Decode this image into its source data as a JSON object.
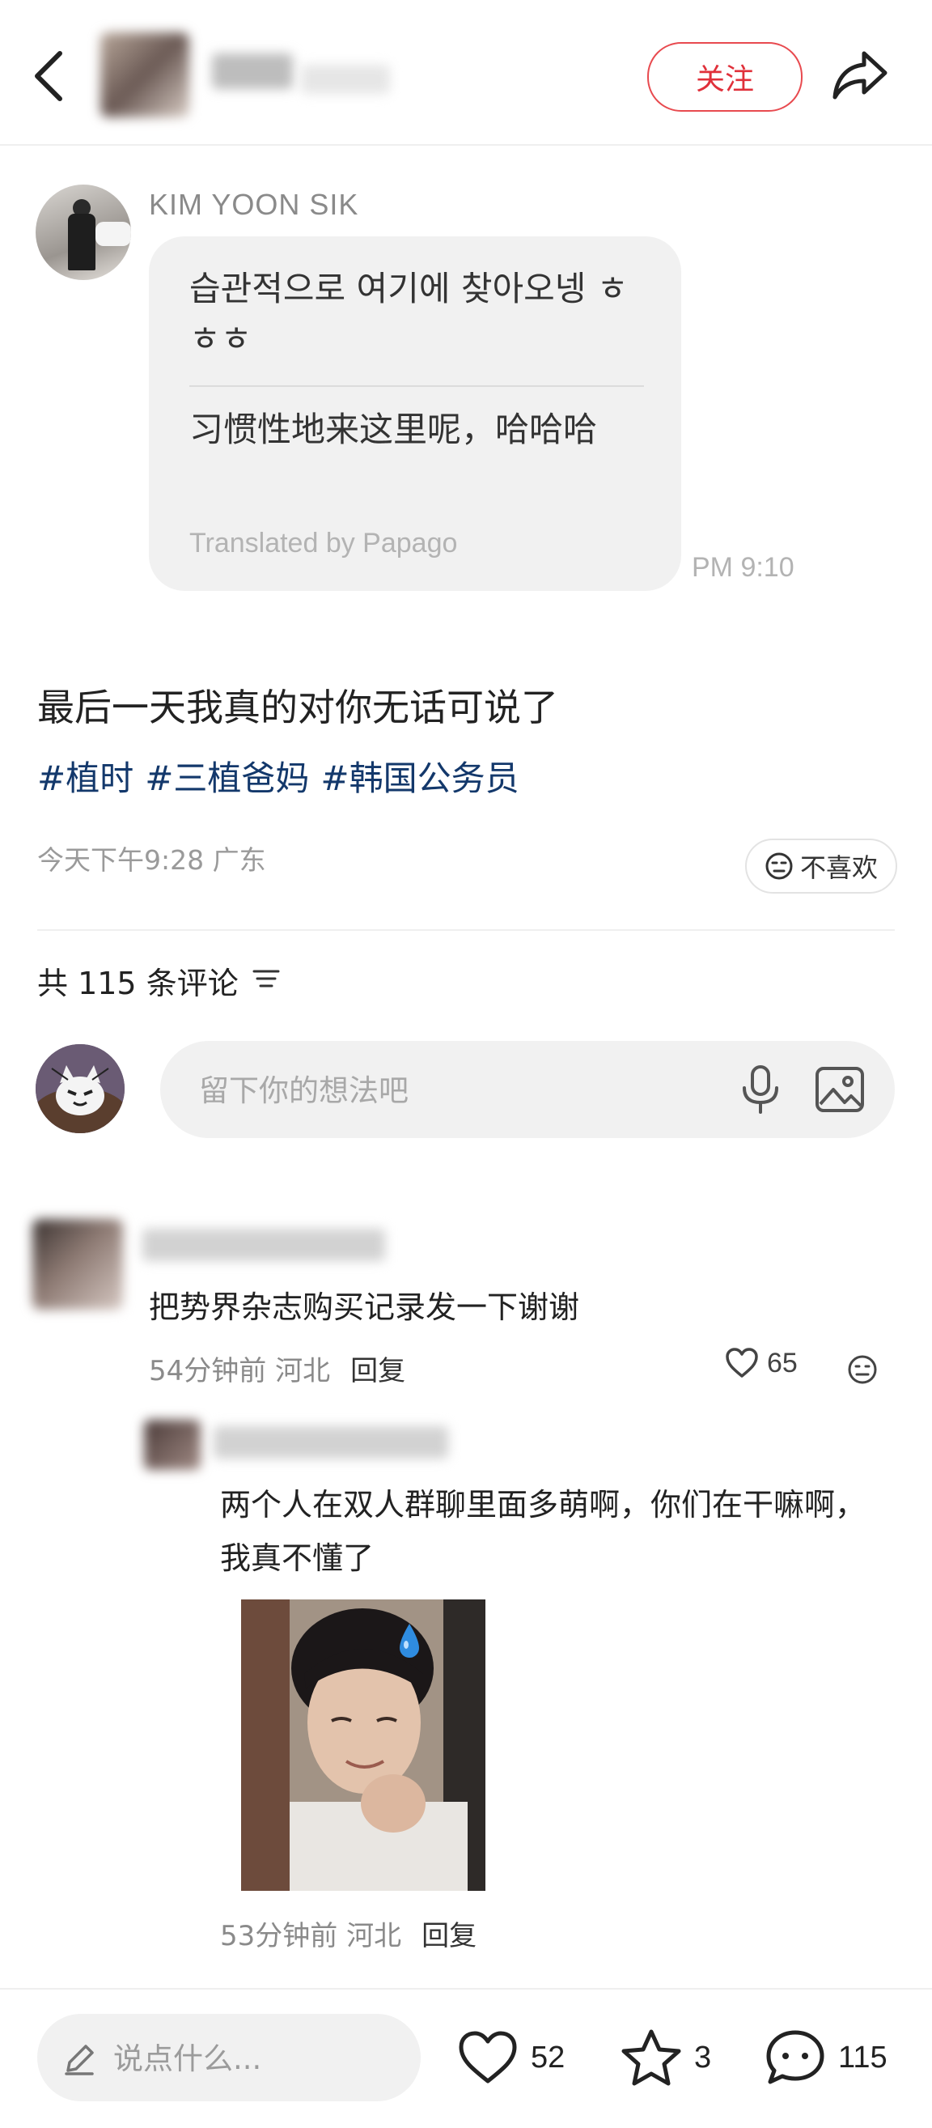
{
  "header": {
    "follow_label": "关注"
  },
  "chat_card": {
    "sender_name": "KIM YOON SIK",
    "message_ko": "습관적으로 여기에 찾아오넹 ㅎㅎㅎ",
    "message_zh": "习惯性地来这里呢，哈哈哈",
    "translated_by": "Translated by Papago",
    "time": "PM 9:10"
  },
  "post": {
    "title": "最后一天我真的对你无话可说了",
    "tags": [
      "#植时",
      "#三植爸妈",
      "#韩国公务员"
    ],
    "meta": "今天下午9:28 广东",
    "dislike_label": "不喜欢"
  },
  "comments_header": {
    "count_label": "共 115 条评论"
  },
  "comment_input": {
    "placeholder": "留下你的想法吧"
  },
  "comments": [
    {
      "text": "把势界杂志购买记录发一下谢谢",
      "meta": "54分钟前 河北",
      "reply_label": "回复",
      "likes": "65"
    }
  ],
  "replies": [
    {
      "text": "两个人在双人群聊里面多萌啊，你们在干嘛啊，我真不懂了",
      "meta": "53分钟前 河北",
      "reply_label": "回复"
    }
  ],
  "bottom_bar": {
    "say_placeholder": "说点什么...",
    "likes": "52",
    "stars": "3",
    "comments": "115"
  },
  "colors": {
    "accent_red": "#e0303a",
    "tag_blue": "#13386b",
    "bubble_bg": "#f1f1f1"
  },
  "icons": [
    "back-icon",
    "share-icon",
    "dislike-face-icon",
    "sort-icon",
    "mic-icon",
    "image-icon",
    "heart-icon",
    "smile-icon",
    "pencil-icon",
    "star-icon",
    "comment-icon"
  ]
}
